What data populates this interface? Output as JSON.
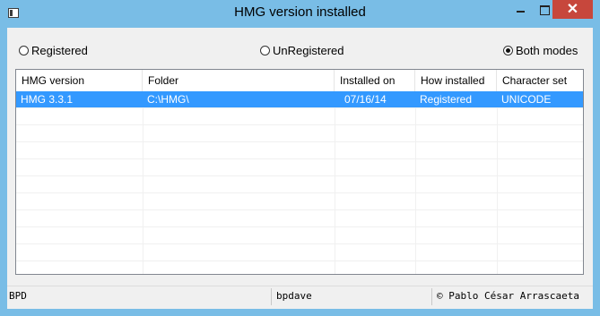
{
  "window": {
    "title": "HMG version installed",
    "close_symbol": "✕"
  },
  "modes": [
    {
      "label": "Registered",
      "checked": false
    },
    {
      "label": "UnRegistered",
      "checked": false
    },
    {
      "label": "Both modes",
      "checked": true
    }
  ],
  "grid": {
    "columns": [
      "HMG version",
      "Folder",
      "Installed on",
      "How installed",
      "Character set"
    ],
    "rows": [
      {
        "version": "HMG 3.3.1",
        "folder": "C:\\HMG\\",
        "installed_on": "07/16/14",
        "how": "Registered",
        "charset": "UNICODE",
        "selected": true
      }
    ],
    "selection_color": "#3399ff"
  },
  "statusbar": {
    "left": "BPD",
    "middle": "bpdave",
    "right": "© Pablo César Arrascaeta"
  },
  "colors": {
    "frame": "#79bde6",
    "close": "#c7473c"
  }
}
